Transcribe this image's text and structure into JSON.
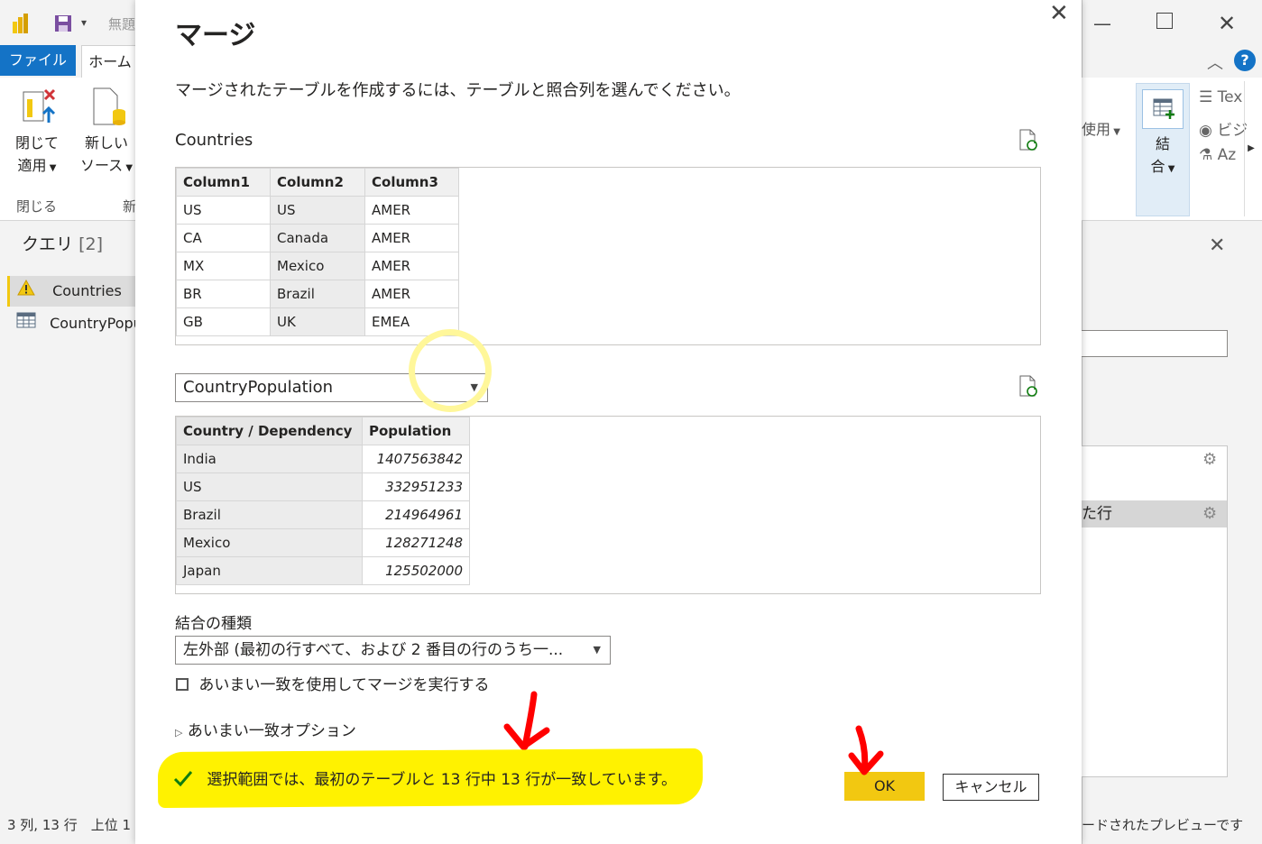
{
  "background": {
    "qat_text": "無題",
    "tab_file": "ファイル",
    "tab_home": "ホーム",
    "ribbon_close_apply": [
      "閉じて",
      "適用"
    ],
    "ribbon_new_source": [
      "新しい",
      "ソース"
    ],
    "group_close": "閉じる",
    "group_new_fragment": "新",
    "queries_title": "クエリ",
    "queries_count": "[2]",
    "queries": [
      {
        "label": "Countries",
        "icon": "warning-icon"
      },
      {
        "label": "CountryPopulation",
        "icon": "table-icon"
      }
    ],
    "status_left": "3 列, 13 行　上位 1",
    "right_ribbon_use": "使用",
    "right_ribbon_combine": [
      "結",
      "合"
    ],
    "right_ribbon_items": [
      "Tex",
      "ビジ",
      "Az"
    ],
    "right_step_label": "た行",
    "status_right": "ードされたプレビューです"
  },
  "dialog": {
    "title": "マージ",
    "description": "マージされたテーブルを作成するには、テーブルと照合列を選んでください。",
    "table1_name": "Countries",
    "table1": {
      "columns": [
        "Column1",
        "Column2",
        "Column3"
      ],
      "rows": [
        [
          "US",
          "US",
          "AMER"
        ],
        [
          "CA",
          "Canada",
          "AMER"
        ],
        [
          "MX",
          "Mexico",
          "AMER"
        ],
        [
          "BR",
          "Brazil",
          "AMER"
        ],
        [
          "GB",
          "UK",
          "EMEA"
        ]
      ]
    },
    "table2_select": "CountryPopulation",
    "table2": {
      "columns": [
        "Country / Dependency",
        "Population"
      ],
      "rows": [
        [
          "India",
          "1407563842"
        ],
        [
          "US",
          "332951233"
        ],
        [
          "Brazil",
          "214964961"
        ],
        [
          "Mexico",
          "128271248"
        ],
        [
          "Japan",
          "125502000"
        ]
      ]
    },
    "join_kind_label": "結合の種類",
    "join_kind_value": "左外部 (最初の行すべて、および 2 番目の行のうち一...",
    "fuzzy_checkbox_label": "あいまい一致を使用してマージを実行する",
    "fuzzy_options_label": "あいまい一致オプション",
    "match_message": "選択範囲では、最初のテーブルと 13 行中 13 行が一致しています。",
    "ok_label": "OK",
    "cancel_label": "キャンセル"
  },
  "colors": {
    "accent_blue": "#1473c6",
    "powerbi_yellow": "#f2c811",
    "highlight_yellow": "#fff200",
    "annotation_red": "#ff0000",
    "check_green": "#107c10"
  }
}
